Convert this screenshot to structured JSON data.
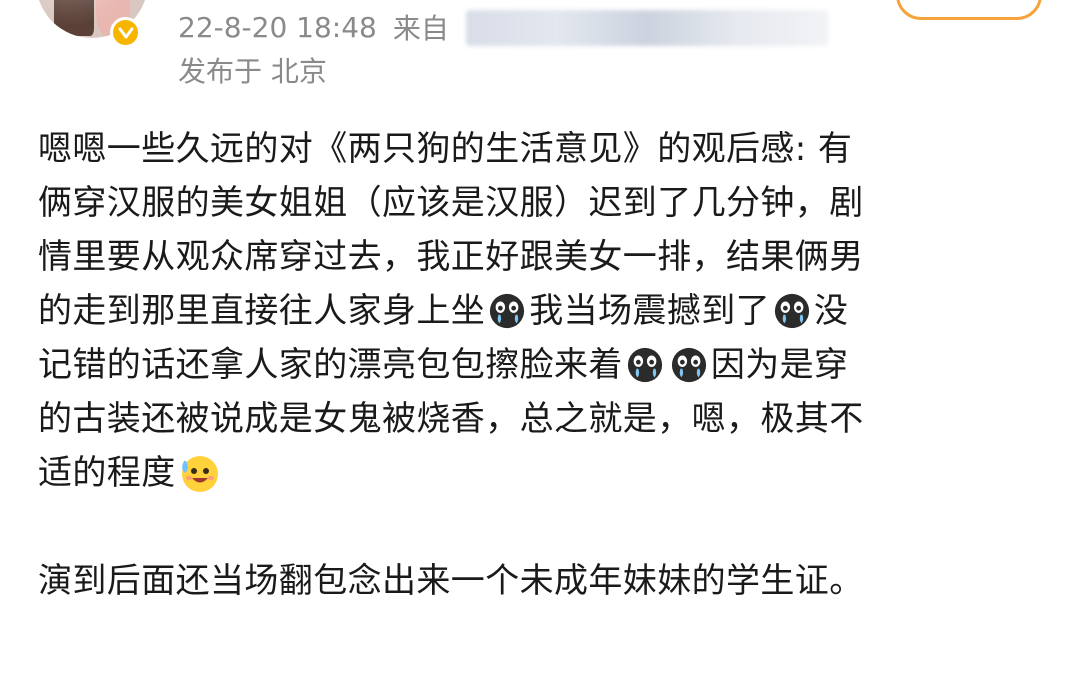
{
  "post": {
    "timestamp": "22-8-20 18:48",
    "source_prefix": "来自",
    "location": "发布于 北京",
    "paragraphs": [
      "嗯嗯一些久远的对《两只狗的生活意见》的观后感: 有俩穿汉服的美女姐姐（应该是汉服）迟到了几分钟，剧情里要从观众席穿过去，我正好跟美女一排，结果俩男的走到那里直接往人家身上坐[cry]我当场震撼到了[cry]没记错的话还拿人家的漂亮包包擦脸来着[cry][cry]因为是穿的古装还被说成是女鬼被烧香，总之就是，嗯，极其不适的程度[sweat-smile]",
      "演到后面还当场翻包念出来一个未成年妹妹的学生证。"
    ],
    "lines": {
      "l1": "嗯嗯一些久远的对《两只狗的生活意见》的观后感: 有",
      "l2": "俩穿汉服的美女姐姐（应该是汉服）迟到了几分钟，剧",
      "l3": "情里要从观众席穿过去，我正好跟美女一排，结果俩男",
      "l4a": "的走到那里直接往人家身上坐",
      "l4b": "我当场震撼到了",
      "l4c": "没",
      "l5a": "记错的话还拿人家的漂亮包包擦脸来着",
      "l5b": "因为是穿",
      "l6": "的古装还被说成是女鬼被烧香，总之就是，嗯，极其不",
      "l7": "适的程度",
      "l8": "演到后面还当场翻包念出来一个未成年妹妹的学生证。"
    }
  },
  "icons": {
    "verified": "verified-badge-icon",
    "emoji_cry": "crying-emoji-icon",
    "emoji_smile": "sweat-smile-emoji-icon"
  },
  "colors": {
    "meta_text": "#8a8a8a",
    "body_text": "#1a1a1a",
    "verified": "#f7b500",
    "follow_border": "#f7a23b"
  }
}
